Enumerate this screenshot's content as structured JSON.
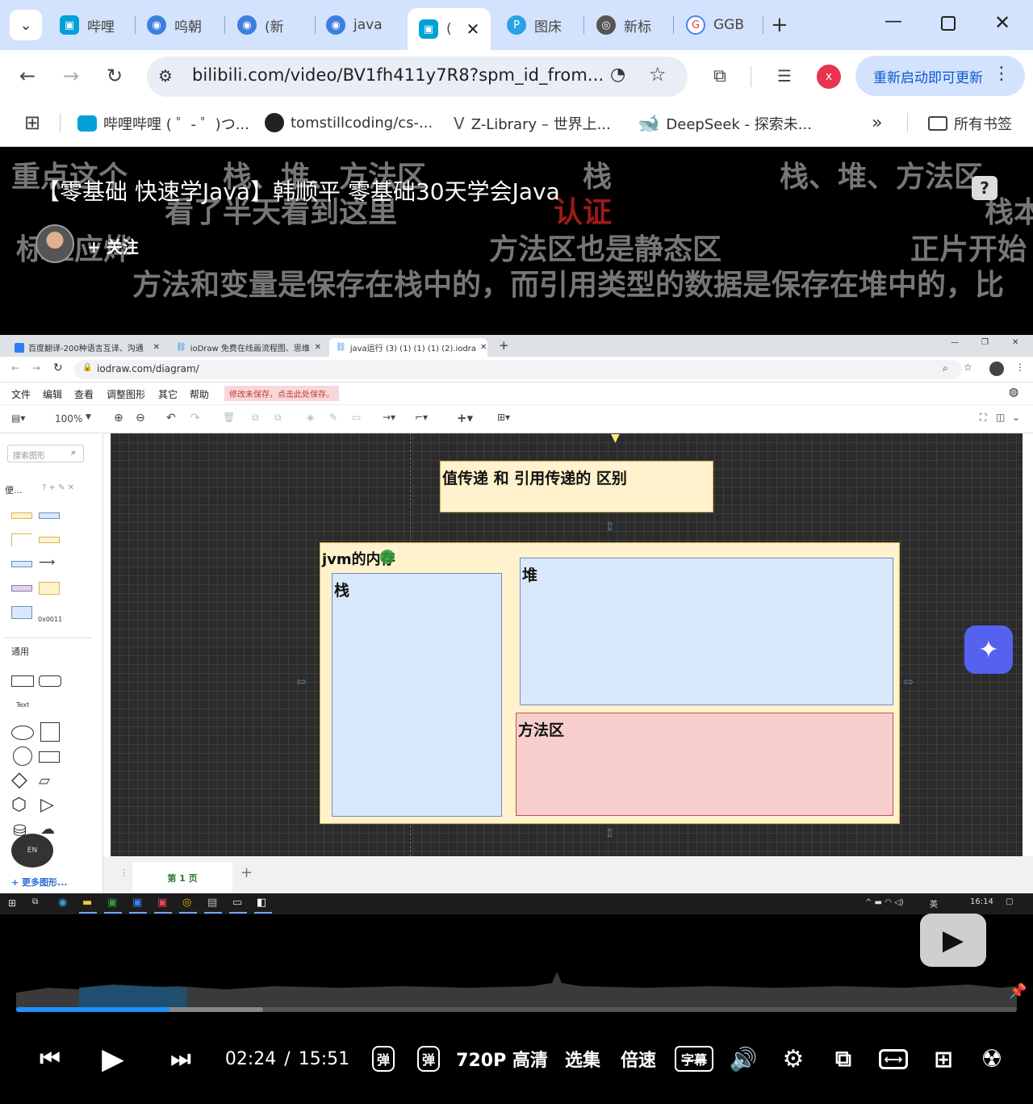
{
  "browser": {
    "tabs": [
      {
        "label": "哔哩",
        "icon": "bilibili-icon"
      },
      {
        "label": "呜朝",
        "icon": "bilibili-tv-icon"
      },
      {
        "label": "(新",
        "icon": "bilibili-tv-icon"
      },
      {
        "label": "java",
        "icon": "bilibili-tv-icon"
      },
      {
        "label": "(",
        "icon": "bilibili-icon"
      },
      {
        "label": "图床",
        "icon": "picgo-icon"
      },
      {
        "label": "新标",
        "icon": "chrome-icon"
      },
      {
        "label": "GGB",
        "icon": "google-icon"
      }
    ],
    "url": "bilibili.com/video/BV1fh411y7R8?spm_id_from...",
    "profile_initial": "x",
    "update_label": "重新启动即可更新",
    "bookmarks": [
      {
        "label": "哔哩哔哩 ( ゜- ゜)つ...",
        "icon": "bilibili-icon"
      },
      {
        "label": "tomstillcoding/cs-...",
        "icon": "github-icon"
      },
      {
        "label": "Z-Library – 世界上...",
        "icon": "zlibrary-icon"
      },
      {
        "label": "DeepSeek - 探索未...",
        "icon": "deepseek-icon"
      }
    ],
    "all_bookmarks_label": "所有书签"
  },
  "video": {
    "title": "【零基础 快速学Java】韩顺平 零基础30天学会Java",
    "follow_label": "+ 关注",
    "danmaku": [
      "重点这个",
      "栈、堆、方法区",
      "栈",
      "栈、堆、方法区",
      "看了半天看到这里",
      "认证",
      "栈本",
      "标上应烨",
      "方法区也是静态区",
      "正片开始",
      "方法和变量是保存在栈中的，而引用类型的数据是保存在堆中的，比"
    ]
  },
  "screen": {
    "tabs": [
      "百度翻译-200种语言互译、沟通",
      "ioDraw 免费在线画流程图、思维",
      "java运行 (3) (1) (1) (1) (2).iodra"
    ],
    "url": "iodraw.com/diagram/",
    "menu": [
      "文件",
      "编辑",
      "查看",
      "调整图形",
      "其它",
      "帮助"
    ],
    "unsaved_notice": "修改未保存，点击此处保存。",
    "zoom": "100%",
    "search_placeholder": "搜索图形",
    "section_favorites": "便...",
    "section_general": "通用",
    "shape_text_label": "Text",
    "shape_addr_label": "0x0011",
    "more_shapes": "+ 更多图形...",
    "page_tab": "第 1 页",
    "diagram": {
      "title_box": "值传递 和 引用传递的 区别",
      "jvm_label": "jvm的内存",
      "stack_label": "栈",
      "heap_label": "堆",
      "method_label": "方法区"
    },
    "taskbar_time": "16:14",
    "taskbar_lang": "英"
  },
  "player": {
    "current_time": "02:24",
    "separator": "/",
    "duration": "15:51",
    "progress_fraction": 0.153,
    "buffered_fraction": 0.247,
    "quality": "720P 高清",
    "episodes": "选集",
    "speed": "倍速"
  },
  "colors": {
    "chrome_tabstrip": "#d3e3fd",
    "bilibili_blue": "#00a1d6",
    "progress": "#1e90ff",
    "stack_fill": "#dae8fc",
    "method_fill": "#f8cecc",
    "container_fill": "#fff2cc"
  }
}
